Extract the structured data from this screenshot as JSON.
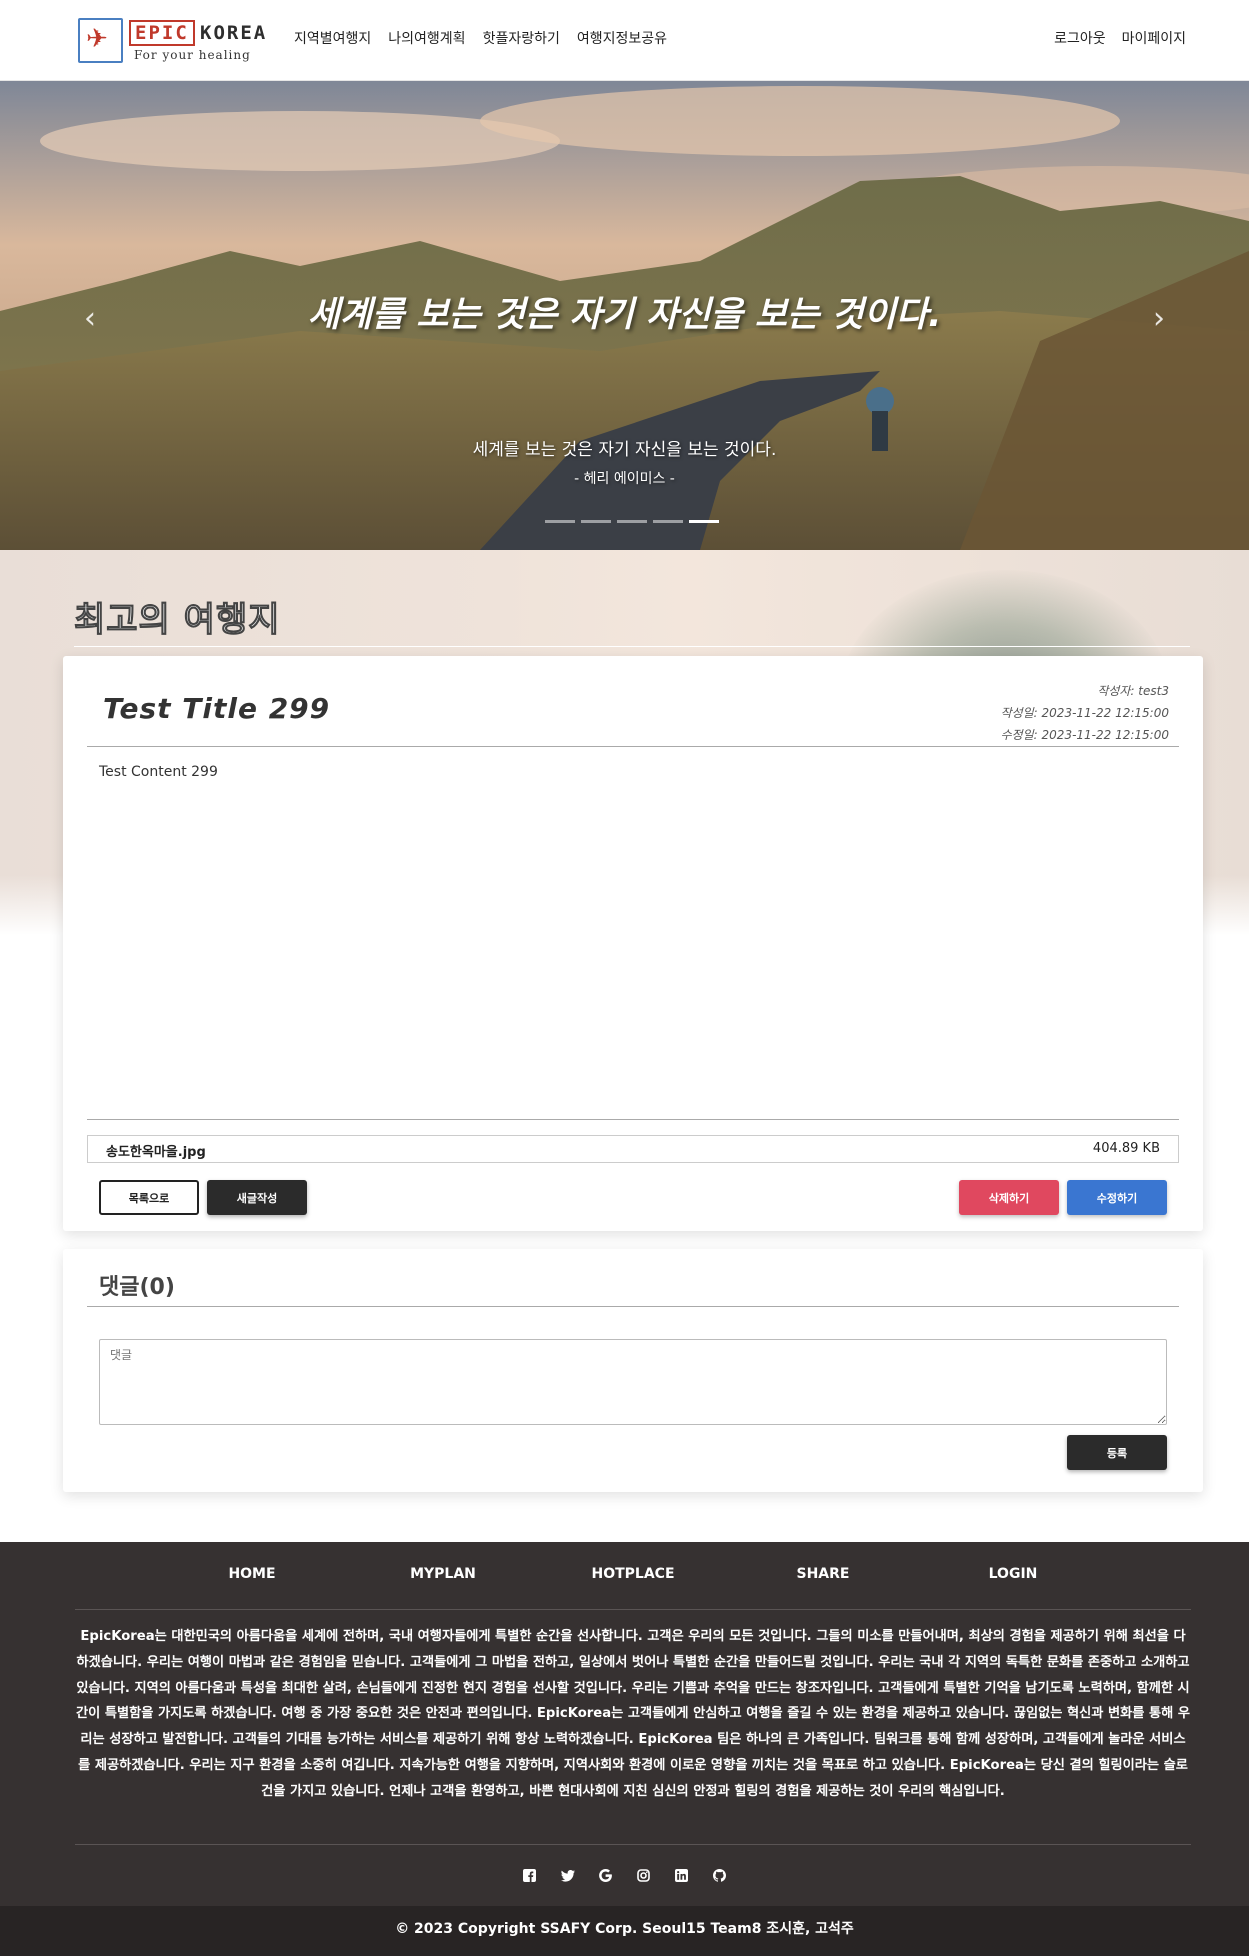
{
  "nav": {
    "logo_epic": "EPIC",
    "logo_korea": "KOREA",
    "logo_tagline": "For your healing",
    "links": [
      "지역별여행지",
      "나의여행계획",
      "핫플자랑하기",
      "여행지정보공유"
    ],
    "right_links": [
      "로그아웃",
      "마이페이지"
    ]
  },
  "hero": {
    "title": "세계를 보는 것은 자기 자신을 보는 것이다.",
    "subtitle": "세계를 보는 것은 자기 자신을 보는 것이다.",
    "author": "- 헤리 에이미스 -",
    "prev_icon": "chevron-left-icon",
    "next_icon": "chevron-right-icon",
    "prev_glyph": "‹",
    "next_glyph": "›",
    "slides_count": 5,
    "active_slide": 5
  },
  "section": {
    "title": "최고의 여행지"
  },
  "post": {
    "title": "Test Title 299",
    "author": "작성자: test3",
    "created": "작성일: 2023-11-22 12:15:00",
    "updated": "수정일: 2023-11-22 12:15:00",
    "content": "Test Content 299",
    "file_name": "송도한옥마을.jpg",
    "file_size": "404.89 KB",
    "btn_list": "목록으로",
    "btn_new": "새글작성",
    "btn_delete": "삭제하기",
    "btn_edit": "수정하기"
  },
  "comments": {
    "title": "댓글(0)",
    "placeholder": "댓글",
    "submit": "등록"
  },
  "footer": {
    "nav": [
      "HOME",
      "MYPLAN",
      "HOTPLACE",
      "SHARE",
      "LOGIN"
    ],
    "text": "EpicKorea는 대한민국의 아름다움을 세계에 전하며, 국내 여행자들에게 특별한 순간을 선사합니다. 고객은 우리의 모든 것입니다. 그들의 미소를 만들어내며, 최상의 경험을 제공하기 위해 최선을 다하겠습니다. 우리는 여행이 마법과 같은 경험임을 믿습니다. 고객들에게 그 마법을 전하고, 일상에서 벗어나 특별한 순간을 만들어드릴 것입니다. 우리는 국내 각 지역의 독특한 문화를 존중하고 소개하고 있습니다. 지역의 아름다움과 특성을 최대한 살려, 손님들에게 진정한 현지 경험을 선사할 것입니다. 우리는 기쁨과 추억을 만드는 창조자입니다. 고객들에게 특별한 기억을 남기도록 노력하며, 함께한 시간이 특별함을 가지도록 하겠습니다. 여행 중 가장 중요한 것은 안전과 편의입니다. EpicKorea는 고객들에게 안심하고 여행을 즐길 수 있는 환경을 제공하고 있습니다. 끊임없는 혁신과 변화를 통해 우리는 성장하고 발전합니다. 고객들의 기대를 능가하는 서비스를 제공하기 위해 항상 노력하겠습니다. EpicKorea 팀은 하나의 큰 가족입니다. 팀워크를 통해 함께 성장하며, 고객들에게 놀라운 서비스를 제공하겠습니다. 우리는 지구 환경을 소중히 여깁니다. 지속가능한 여행을 지향하며, 지역사회와 환경에 이로운 영향을 끼치는 것을 목표로 하고 있습니다. EpicKorea는 당신 곁의 힐링이라는 슬로건을 가지고 있습니다. 언제나 고객을 환영하고, 바쁜 현대사회에 지친 심신의 안정과 힐링의 경험을 제공하는 것이 우리의 핵심입니다.",
    "socials": [
      "facebook-icon",
      "twitter-icon",
      "google-icon",
      "instagram-icon",
      "linkedin-icon",
      "github-icon"
    ],
    "copyright": "© 2023 Copyright SSAFY Corp. Seoul15 Team8 조시훈, 고석주"
  },
  "colors": {
    "danger": "#e0485f",
    "primary": "#3a76d1",
    "dark": "#2b2b2b",
    "footer_bg": "#363131",
    "brand_red": "#c0392b",
    "brand_blue": "#4a7fc1"
  }
}
